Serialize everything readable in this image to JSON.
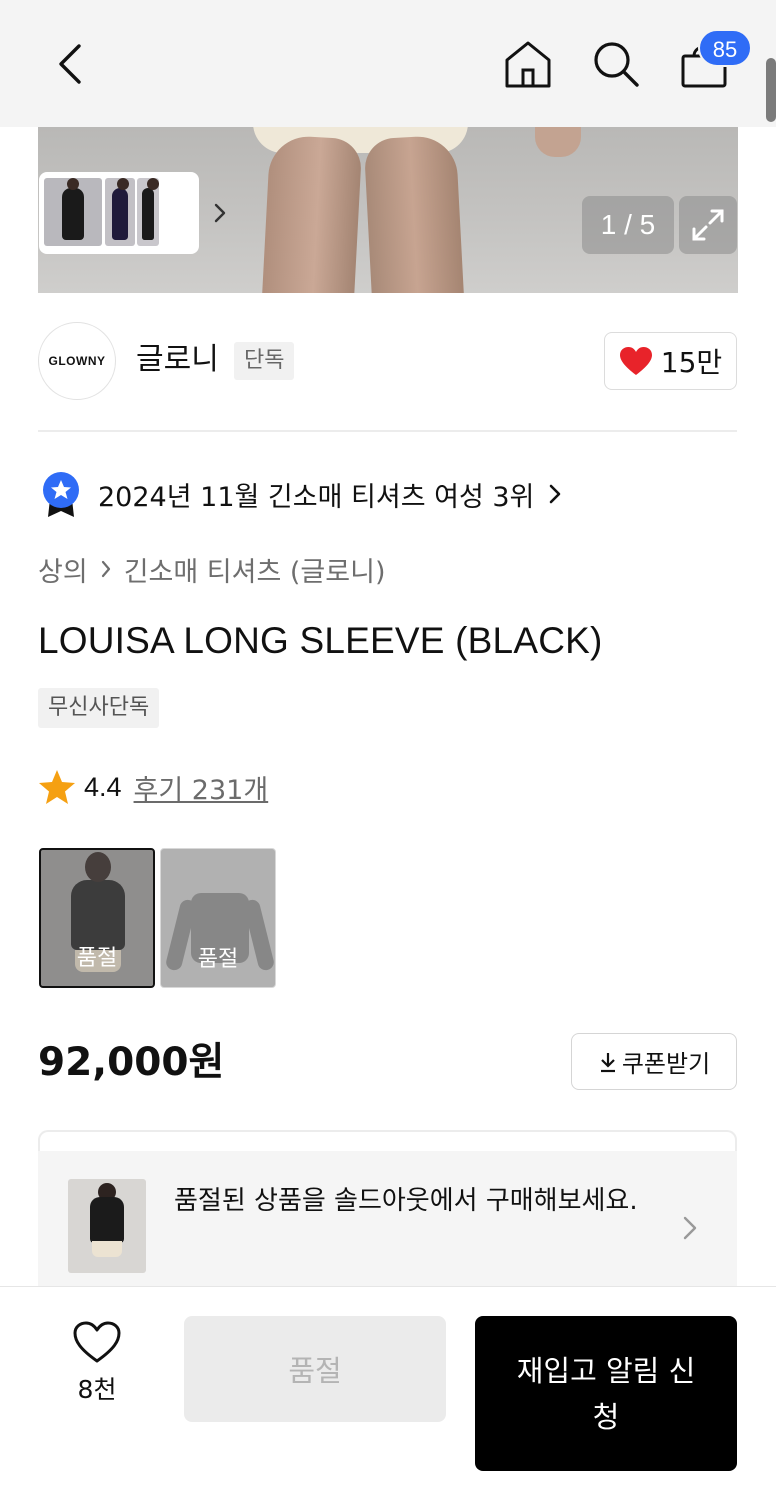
{
  "topbar": {
    "cart_count": "85"
  },
  "gallery": {
    "pager": "1 / 5"
  },
  "brand": {
    "logo_text": "GLOWNY",
    "name": "글로니",
    "tag": "단독",
    "likes": "15만"
  },
  "ranking": {
    "text": "2024년 11월 긴소매 티셔츠 여성 3위"
  },
  "category": {
    "parent": "상의",
    "child": "긴소매 티셔츠 (글로니)"
  },
  "product": {
    "title": "LOUISA LONG SLEEVE (BLACK)",
    "badge": "무신사단독",
    "rating": "4.4",
    "review_link": "후기 231개",
    "price": "92,000원",
    "coupon_label": "쿠폰받기",
    "options": [
      {
        "label": "품절",
        "selected": true
      },
      {
        "label": "품절",
        "selected": false
      }
    ]
  },
  "soldout_banner": {
    "text": "품절된 상품을 솔드아웃에서 구매해보세요."
  },
  "bottom_bar": {
    "wish_count": "8천",
    "soldout_label": "품절",
    "restock_label": "재입고 알림 신청"
  },
  "colors": {
    "accent": "#2f6cf6",
    "heart": "#e8232a",
    "star": "#f5a012",
    "primary_button": "#000000"
  }
}
